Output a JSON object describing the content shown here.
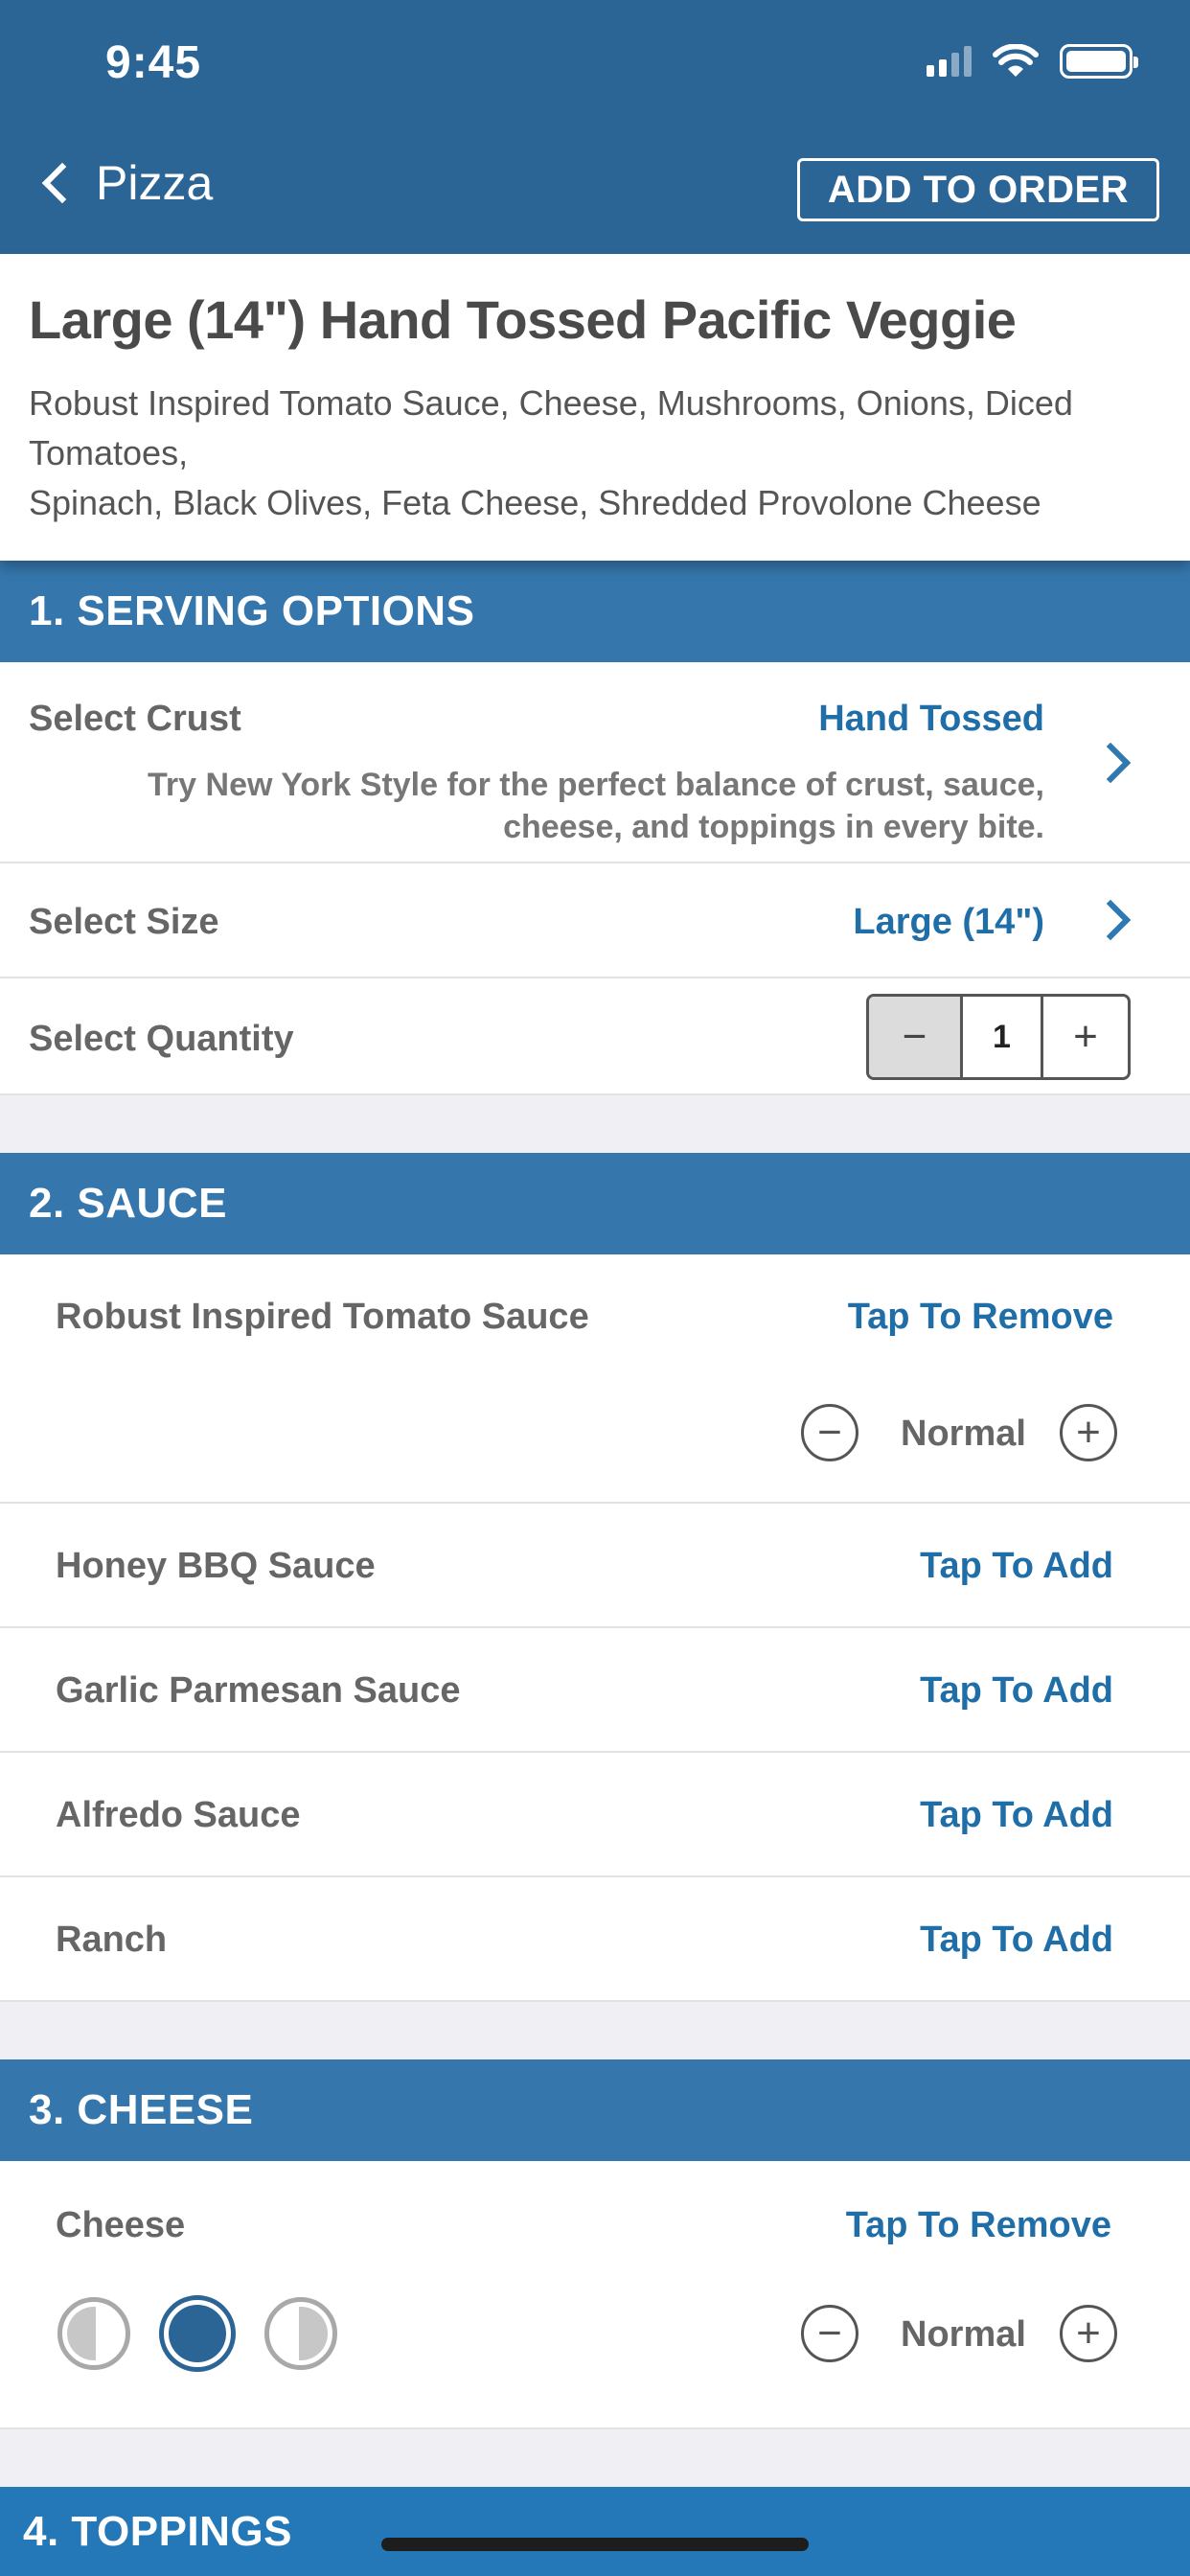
{
  "status": {
    "time": "9:45"
  },
  "nav": {
    "back_label": "Pizza",
    "add_to_order": "ADD TO ORDER"
  },
  "product": {
    "title": "Large (14\") Hand Tossed Pacific Veggie",
    "description_line1": "Robust Inspired Tomato Sauce, Cheese, Mushrooms, Onions, Diced Tomatoes,",
    "description_line2": "Spinach, Black Olives, Feta Cheese, Shredded Provolone Cheese"
  },
  "serving": {
    "header": "1. SERVING OPTIONS",
    "crust_label": "Select Crust",
    "crust_value": "Hand Tossed",
    "crust_hint_line1": "Try New York Style for the perfect balance of crust, sauce,",
    "crust_hint_line2": "cheese, and toppings in every bite.",
    "size_label": "Select Size",
    "size_value": "Large (14\")",
    "quantity_label": "Select Quantity",
    "quantity_value": "1",
    "minus": "−",
    "plus": "+"
  },
  "sauce": {
    "header": "2. SAUCE",
    "selected": {
      "name": "Robust Inspired Tomato Sauce",
      "action": "Tap To Remove",
      "amount": "Normal"
    },
    "options": [
      {
        "name": "Honey BBQ Sauce",
        "action": "Tap To Add"
      },
      {
        "name": "Garlic Parmesan Sauce",
        "action": "Tap To Add"
      },
      {
        "name": "Alfredo Sauce",
        "action": "Tap To Add"
      },
      {
        "name": "Ranch",
        "action": "Tap To Add"
      }
    ]
  },
  "cheese": {
    "header": "3. CHEESE",
    "name": "Cheese",
    "action": "Tap To Remove",
    "amount": "Normal",
    "coverage_selected": "whole"
  },
  "toppings": {
    "header": "4. TOPPINGS"
  },
  "colors": {
    "nav": "#2b6596",
    "section": "#3577ad",
    "link": "#1f6ea8"
  }
}
